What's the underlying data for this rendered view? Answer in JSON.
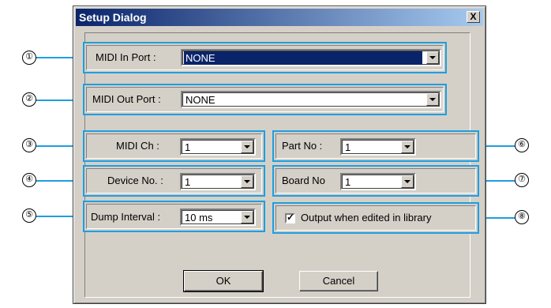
{
  "dialog": {
    "title": "Setup Dialog",
    "close_label": "X"
  },
  "fields": {
    "midi_in": {
      "label": "MIDI In Port :",
      "value": "NONE"
    },
    "midi_out": {
      "label": "MIDI Out Port :",
      "value": "NONE"
    },
    "midi_ch": {
      "label": "MIDI Ch :",
      "value": "1"
    },
    "device_no": {
      "label": "Device No. :",
      "value": "1"
    },
    "dump_interval": {
      "label": "Dump Interval :",
      "value": "10 ms"
    },
    "part_no": {
      "label": "Part No :",
      "value": "1"
    },
    "board_no": {
      "label": "Board No",
      "value": "1"
    },
    "output_edited": {
      "label": "Output when edited in library",
      "checked": true
    }
  },
  "buttons": {
    "ok": "OK",
    "cancel": "Cancel"
  },
  "callouts": [
    "①",
    "②",
    "③",
    "④",
    "⑤",
    "⑥",
    "⑦",
    "⑧"
  ],
  "colors": {
    "callout": "#1e9ee0",
    "title_bar": "#0a246a",
    "face": "#d4d0c8"
  }
}
